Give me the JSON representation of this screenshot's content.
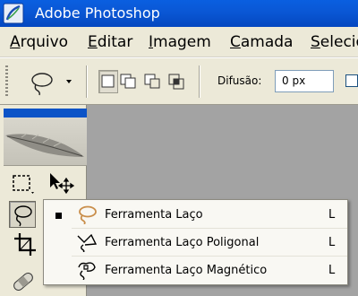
{
  "window": {
    "title": "Adobe Photoshop"
  },
  "menu": {
    "items": [
      {
        "u": "A",
        "rest": "rquivo"
      },
      {
        "u": "E",
        "rest": "ditar"
      },
      {
        "u": "I",
        "rest": "magem"
      },
      {
        "u": "C",
        "rest": "amada"
      },
      {
        "u": "S",
        "rest": "elecio"
      }
    ]
  },
  "options": {
    "feather_label": "Difusão:",
    "feather_value": "0 px"
  },
  "flyout": {
    "items": [
      {
        "label": "Ferramenta Laço",
        "shortcut": "L"
      },
      {
        "label": "Ferramenta Laço Poligonal",
        "shortcut": "L"
      },
      {
        "label": "Ferramenta Laço Magnético",
        "shortcut": "L"
      }
    ]
  },
  "colors": {
    "titlebar": "#0a58d6",
    "chrome": "#ece9d8",
    "workspace": "#a3a3a3",
    "lasso_tan": "#c98e4a"
  }
}
